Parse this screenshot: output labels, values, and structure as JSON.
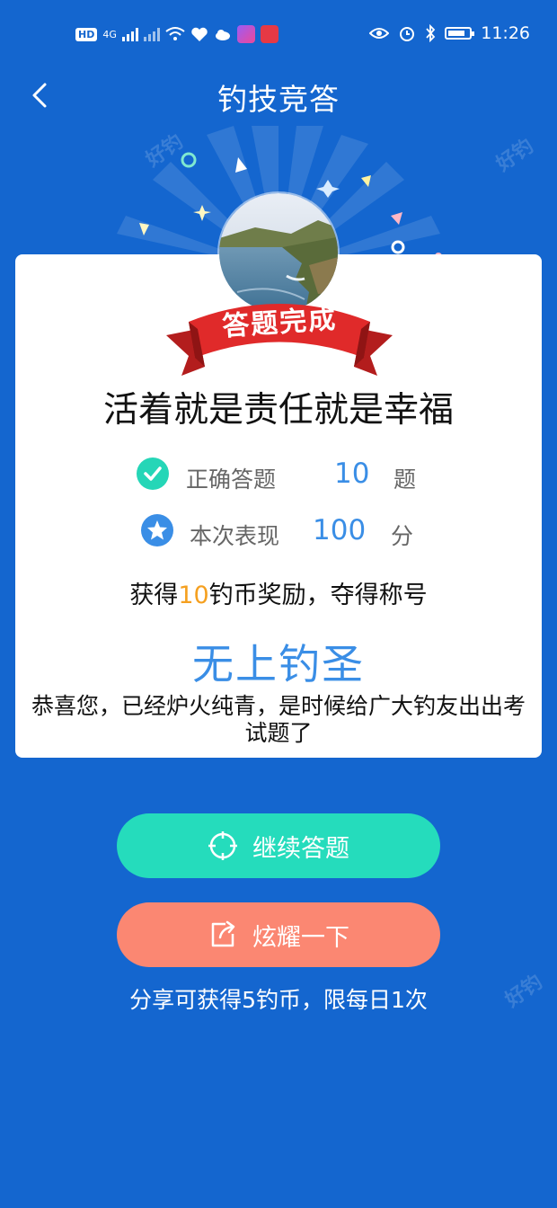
{
  "status_bar": {
    "left_badge": "HD",
    "network": "4G",
    "time": "11:26"
  },
  "header": {
    "title": "钓技竞答"
  },
  "result": {
    "ribbon_text": "答题完成",
    "headline": "活着就是责任就是幸福",
    "stats": [
      {
        "label": "正确答题",
        "value": "10",
        "unit": "题"
      },
      {
        "label": "本次表现",
        "value": "100",
        "unit": "分"
      }
    ],
    "reward_prefix": "获得",
    "reward_amount": "10",
    "reward_suffix": "钓币奖励，夺得称号",
    "honor_title": "无上钓圣",
    "description": "恭喜您，已经炉火纯青，是时候给广大钓友出出考试题了"
  },
  "actions": {
    "continue_label": "继续答题",
    "share_label": "炫耀一下",
    "share_note": "分享可获得5钓币，限每日1次"
  },
  "colors": {
    "background": "#1466cf",
    "accent_blue": "#3a8ee6",
    "continue_button": "#25dcbc",
    "share_button": "#fb8772",
    "ribbon": "#e02a2a",
    "reward_highlight": "#f5a020"
  },
  "icons": [
    "back-arrow-icon",
    "check-circle-icon",
    "star-circle-icon",
    "crosshair-icon",
    "share-icon"
  ]
}
